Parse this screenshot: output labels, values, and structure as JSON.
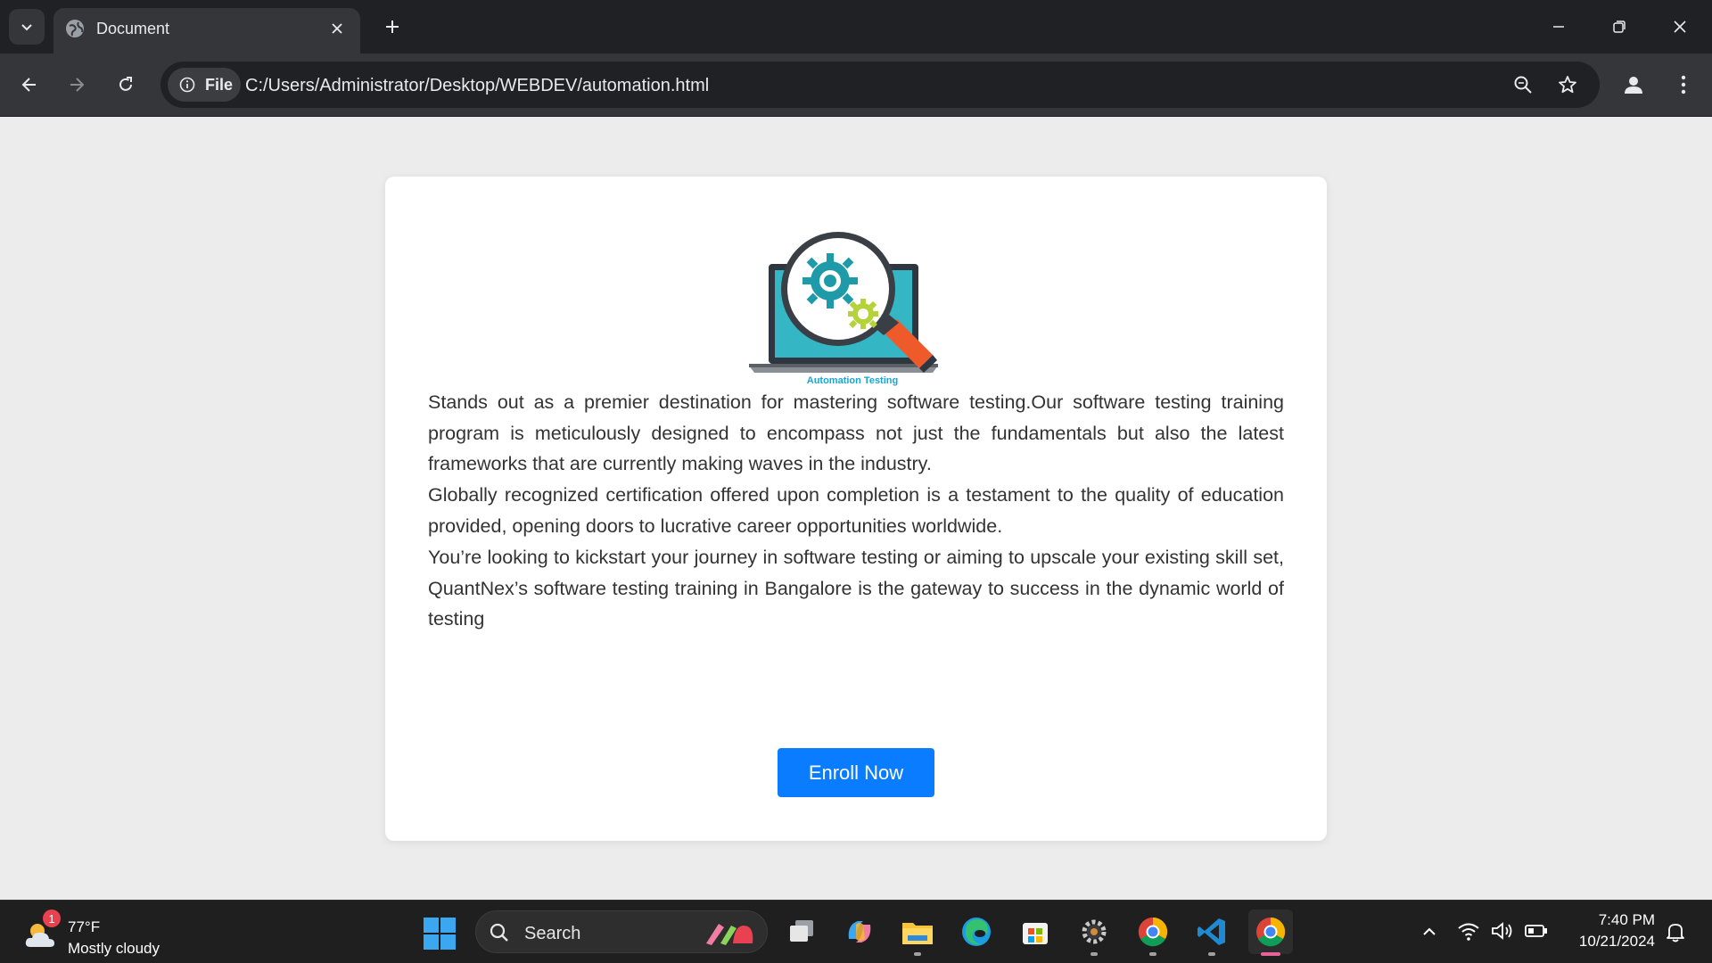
{
  "browser": {
    "tab_title": "Document",
    "address_scheme_label": "File",
    "url": "C:/Users/Administrator/Desktop/WEBDEV/automation.html"
  },
  "page": {
    "logo_caption": "Automation Testing",
    "paragraphs": [
      "Stands out as a premier destination for mastering software testing.Our software testing training program is meticulously designed to encompass not just the fundamentals but also the latest frameworks that are currently making waves in the industry.",
      "Globally recognized certification offered upon completion is a testament to the quality of education provided, opening doors to lucrative career opportunities worldwide.",
      "You’re looking to kickstart your journey in software testing or aiming to upscale your existing skill set, QuantNex’s software testing training in Bangalore is the gateway to success in the dynamic world of testing"
    ],
    "enroll_label": "Enroll Now",
    "enroll_color": "#0a7cff"
  },
  "taskbar": {
    "weather_temp": "77°F",
    "weather_desc": "Mostly cloudy",
    "weather_badge": "1",
    "search_label": "Search",
    "apps": [
      "task-view",
      "copilot",
      "file-explorer",
      "edge",
      "microsoft-store",
      "settings",
      "chrome",
      "vscode",
      "chrome-active"
    ],
    "time": "7:40 PM",
    "date": "10/21/2024"
  }
}
